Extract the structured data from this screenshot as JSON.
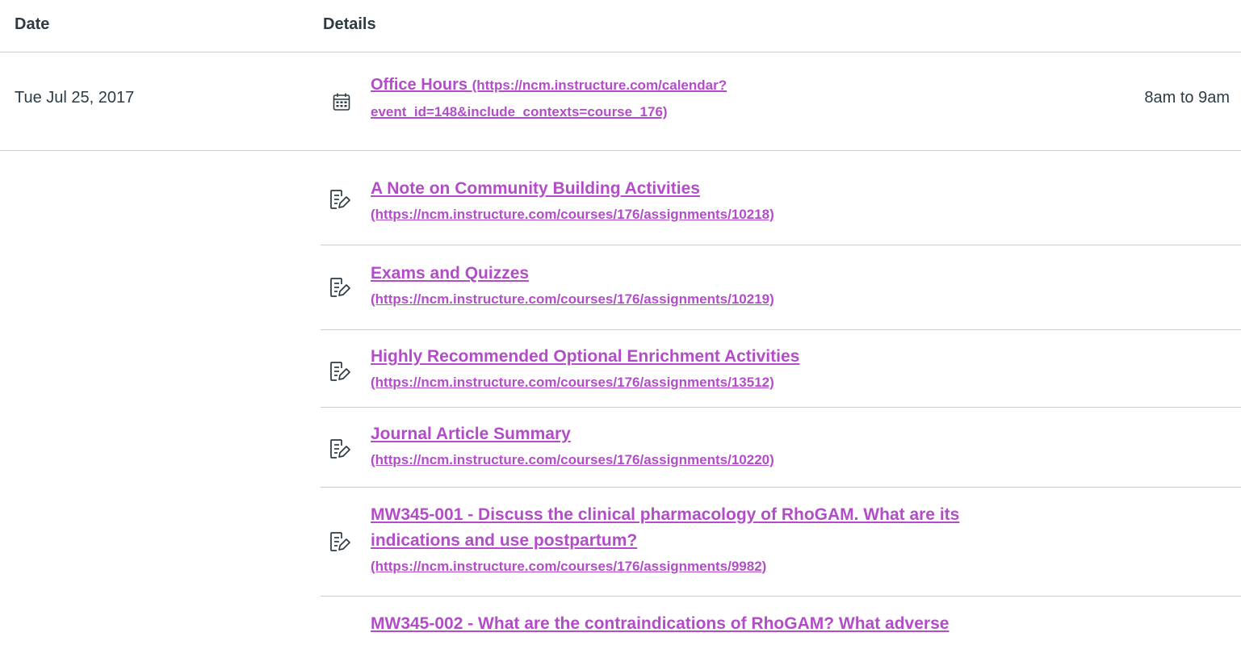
{
  "table": {
    "headers": {
      "date": "Date",
      "details": "Details"
    }
  },
  "event": {
    "date": "Tue Jul 25, 2017",
    "title": "Office Hours",
    "url": "(https://ncm.instructure.com/calendar?event_id=148&include_contexts=course_176)",
    "url_line1": "(https://ncm.instructure.com/calendar?",
    "url_line2": "event_id=148&include_contexts=course_176)",
    "time": "8am to 9am",
    "icon": "calendar-icon"
  },
  "assignments": [
    {
      "title": "A Note on Community Building Activities",
      "url": "(https://ncm.instructure.com/courses/176/assignments/10218)",
      "icon": "assignment-icon"
    },
    {
      "title": "Exams and Quizzes",
      "url": "(https://ncm.instructure.com/courses/176/assignments/10219)",
      "icon": "assignment-icon"
    },
    {
      "title": "Highly Recommended Optional Enrichment Activities",
      "url": "(https://ncm.instructure.com/courses/176/assignments/13512)",
      "icon": "assignment-icon"
    },
    {
      "title": "Journal Article Summary",
      "url": "(https://ncm.instructure.com/courses/176/assignments/10220)",
      "icon": "assignment-icon"
    },
    {
      "title_line1": "MW345-001 - Discuss the clinical pharmacology of RhoGAM. What are its",
      "title_line2": "indications and use postpartum?",
      "url": "(https://ncm.instructure.com/courses/176/assignments/9982)",
      "icon": "assignment-icon"
    },
    {
      "title_line1": "MW345-002 - What are the contraindications of RhoGAM? What adverse",
      "icon": "assignment-icon"
    }
  ],
  "colors": {
    "link": "#b24dc7",
    "text": "#2d3b45",
    "divider": "#c7cdd1"
  }
}
